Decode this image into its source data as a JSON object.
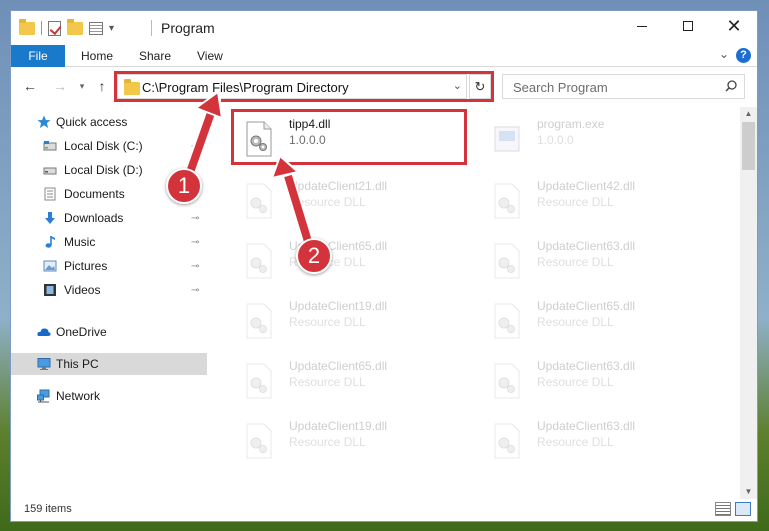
{
  "window": {
    "title": "Program",
    "minimize": "",
    "maximize": "",
    "close": "✕"
  },
  "ribbon": {
    "tabs": [
      "File",
      "Home",
      "Share",
      "View"
    ],
    "collapse": "⌄",
    "help": "?"
  },
  "nav": {
    "back": "←",
    "forward": "→",
    "recent": "▾",
    "up": "↑",
    "address": "C:\\Program Files\\Program Directory",
    "address_dropdown": "⌄",
    "refresh": "↻",
    "search_placeholder": "Search Program"
  },
  "sidebar": {
    "items": [
      {
        "label": "Quick access",
        "icon": "star-icon"
      },
      {
        "label": "Local Disk (C:)",
        "icon": "drive-icon",
        "pinned": true
      },
      {
        "label": "Local Disk (D:)",
        "icon": "drive-icon",
        "pinned": false
      },
      {
        "label": "Documents",
        "icon": "documents-icon",
        "pinned": true
      },
      {
        "label": "Downloads",
        "icon": "downloads-icon",
        "pinned": true
      },
      {
        "label": "Music",
        "icon": "music-icon",
        "pinned": true
      },
      {
        "label": "Pictures",
        "icon": "pictures-icon",
        "pinned": true
      },
      {
        "label": "Videos",
        "icon": "videos-icon",
        "pinned": true
      },
      {
        "label": "OneDrive",
        "icon": "cloud-icon"
      },
      {
        "label": "This PC",
        "icon": "computer-icon"
      },
      {
        "label": "Network",
        "icon": "network-icon"
      }
    ],
    "pin_glyph": "📌"
  },
  "files": [
    {
      "name": "tipp4.dll",
      "desc": "1.0.0.0",
      "icon": "dll-icon"
    },
    {
      "name": "program.exe",
      "desc": "1.0.0.0",
      "icon": "exe-icon"
    },
    {
      "name": "UpdateClient21.dll",
      "desc": "Resource DLL",
      "icon": "dll-icon"
    },
    {
      "name": "UpdateClient42.dll",
      "desc": "Resource DLL",
      "icon": "dll-icon"
    },
    {
      "name": "UpdateClient65.dll",
      "desc": "Resource DLL",
      "icon": "dll-icon"
    },
    {
      "name": "UpdateClient63.dll",
      "desc": "Resource DLL",
      "icon": "dll-icon"
    },
    {
      "name": "UpdateClient19.dll",
      "desc": "Resource DLL",
      "icon": "dll-icon"
    },
    {
      "name": "UpdateClient65.dll",
      "desc": "Resource DLL",
      "icon": "dll-icon"
    },
    {
      "name": "UpdateClient65.dll",
      "desc": "Resource DLL",
      "icon": "dll-icon"
    },
    {
      "name": "UpdateClient63.dll",
      "desc": "Resource DLL",
      "icon": "dll-icon"
    },
    {
      "name": "UpdateClient19.dll",
      "desc": "Resource DLL",
      "icon": "dll-icon"
    },
    {
      "name": "UpdateClient63.dll",
      "desc": "Resource DLL",
      "icon": "dll-icon"
    }
  ],
  "status": {
    "item_count": "159 items"
  },
  "annotations": {
    "step1": "1",
    "step2": "2",
    "highlight_color": "#d3343c"
  },
  "colors": {
    "accent": "#1979ca",
    "selected": "#d9d9d9"
  }
}
